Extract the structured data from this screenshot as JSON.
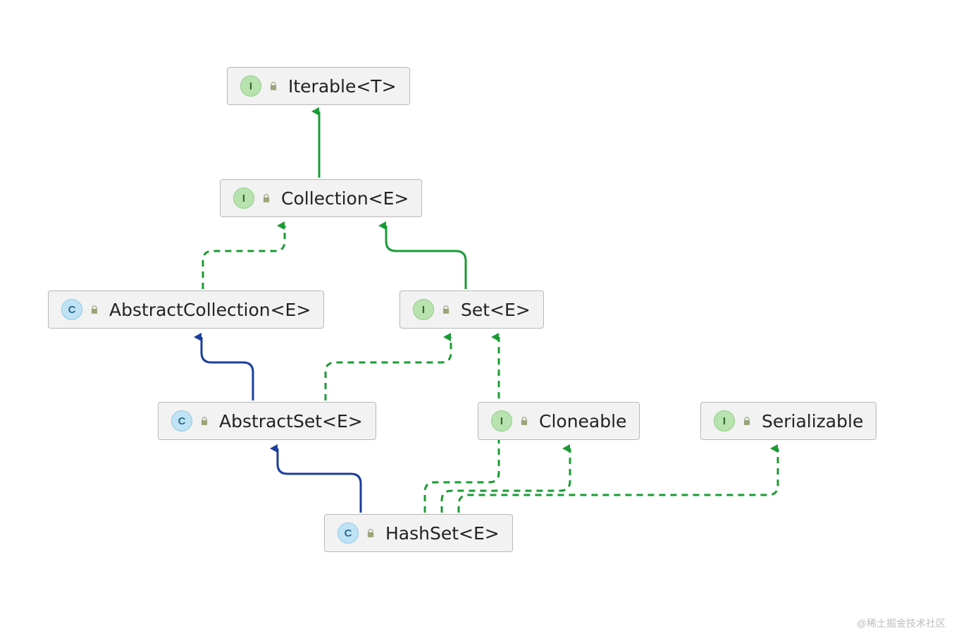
{
  "watermark": "@稀土掘金技术社区",
  "nodes": {
    "iterable": {
      "kind": "interface",
      "label": "Iterable<T>"
    },
    "collection": {
      "kind": "interface",
      "label": "Collection<E>"
    },
    "abstractCollection": {
      "kind": "class",
      "label": "AbstractCollection<E>"
    },
    "set": {
      "kind": "interface",
      "label": "Set<E>"
    },
    "abstractSet": {
      "kind": "class",
      "label": "AbstractSet<E>"
    },
    "cloneable": {
      "kind": "interface",
      "label": "Cloneable"
    },
    "serializable": {
      "kind": "interface",
      "label": "Serializable"
    },
    "hashset": {
      "kind": "class",
      "label": "HashSet<E>"
    }
  },
  "edges": [
    {
      "from": "collection",
      "to": "iterable",
      "style": "extends-interface"
    },
    {
      "from": "abstractCollection",
      "to": "collection",
      "style": "implements"
    },
    {
      "from": "set",
      "to": "collection",
      "style": "extends-interface"
    },
    {
      "from": "abstractSet",
      "to": "abstractCollection",
      "style": "extends-class"
    },
    {
      "from": "abstractSet",
      "to": "set",
      "style": "implements"
    },
    {
      "from": "hashset",
      "to": "abstractSet",
      "style": "extends-class"
    },
    {
      "from": "hashset",
      "to": "set",
      "style": "implements"
    },
    {
      "from": "hashset",
      "to": "cloneable",
      "style": "implements"
    },
    {
      "from": "hashset",
      "to": "serializable",
      "style": "implements"
    }
  ],
  "colors": {
    "extendsClass": "#1b3e9c",
    "extendsInterface": "#189b33",
    "implements": "#189b33"
  }
}
